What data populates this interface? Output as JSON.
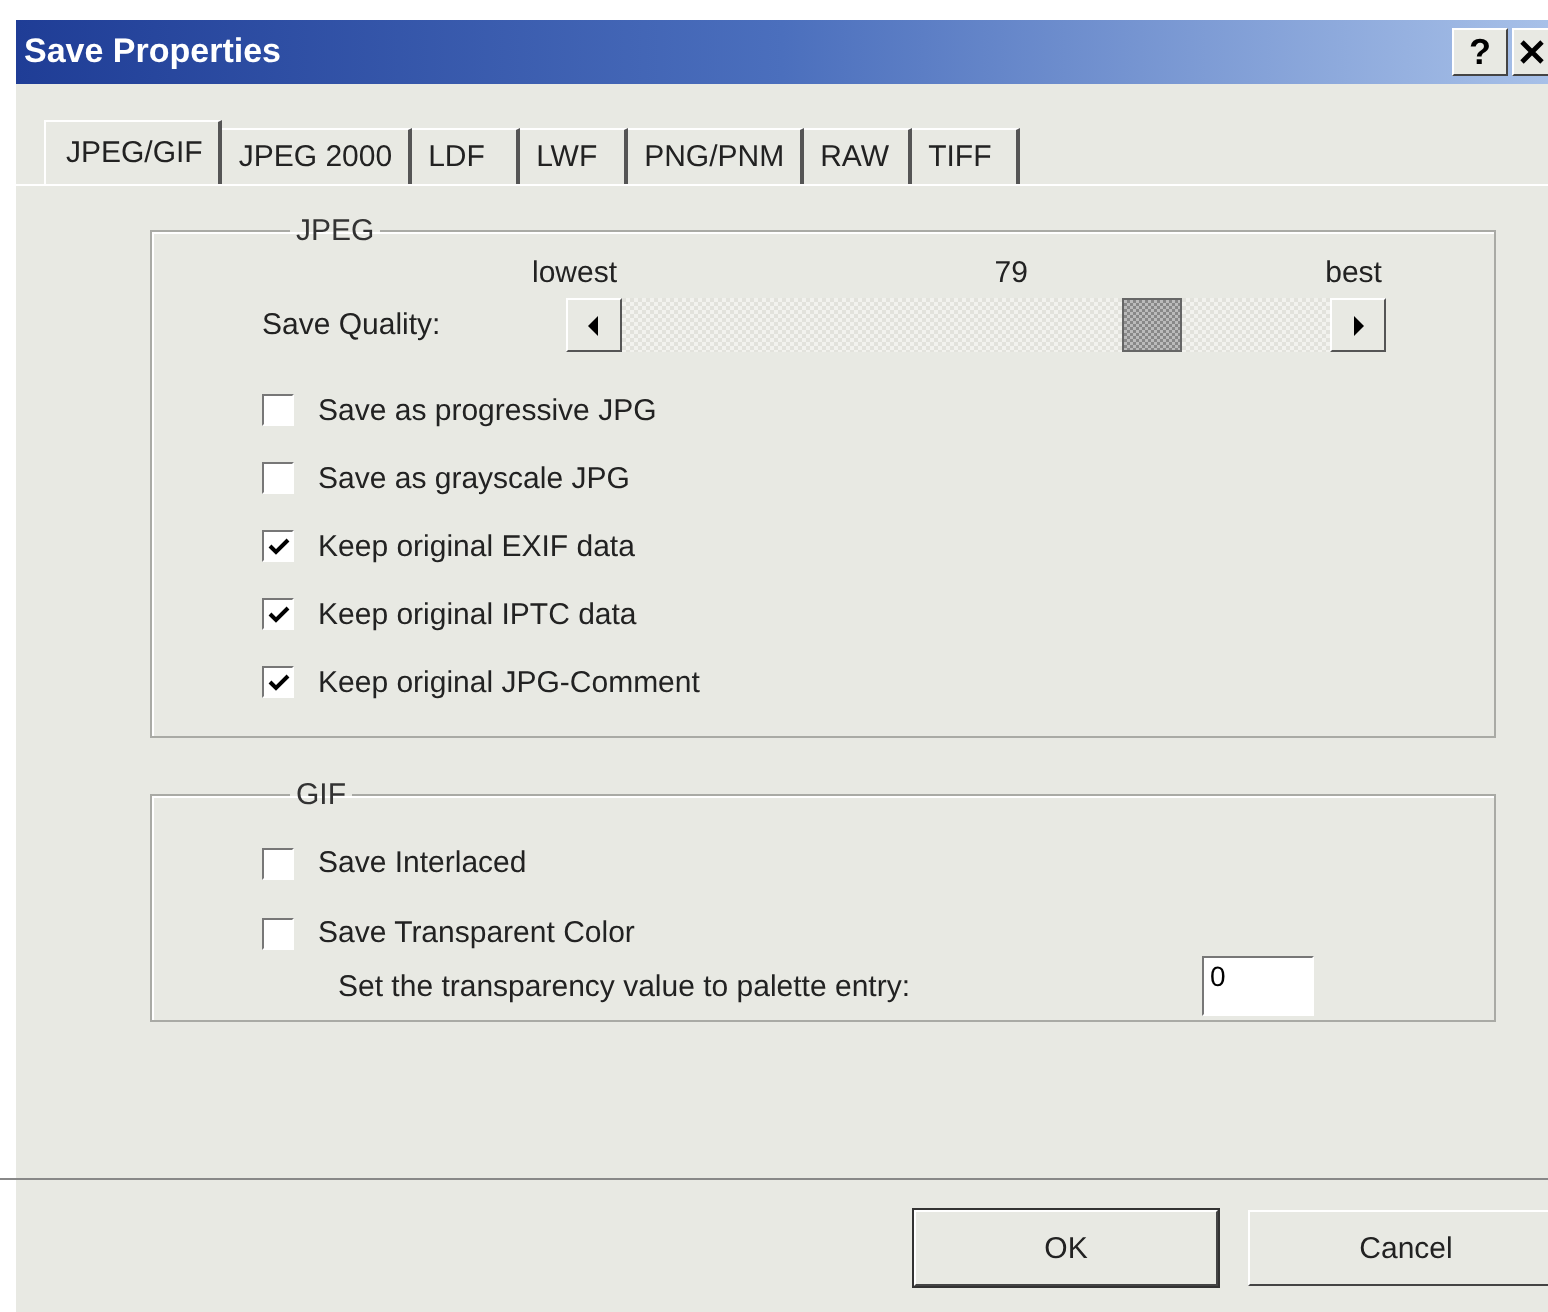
{
  "window": {
    "title": "Save Properties",
    "help": "?"
  },
  "tabs": [
    {
      "label": "JPEG/GIF",
      "selected": true
    },
    {
      "label": "JPEG 2000",
      "selected": false
    },
    {
      "label": "LDF",
      "selected": false
    },
    {
      "label": "LWF",
      "selected": false
    },
    {
      "label": "PNG/PNM",
      "selected": false
    },
    {
      "label": "RAW",
      "selected": false
    },
    {
      "label": "TIFF",
      "selected": false
    }
  ],
  "jpeg": {
    "title": "JPEG",
    "quality": {
      "label": "Save Quality:",
      "min_label": "lowest",
      "value": "79",
      "max_label": "best",
      "level": 0.79
    },
    "options": [
      {
        "label": "Save as progressive JPG",
        "checked": false
      },
      {
        "label": "Save as grayscale JPG",
        "checked": false
      },
      {
        "label": "Keep original EXIF data",
        "checked": true
      },
      {
        "label": "Keep original IPTC data",
        "checked": true
      },
      {
        "label": "Keep original JPG-Comment",
        "checked": true
      }
    ]
  },
  "gif": {
    "title": "GIF",
    "options": [
      {
        "label": "Save Interlaced",
        "checked": false
      },
      {
        "label": "Save Transparent Color",
        "checked": false
      }
    ],
    "palette_entry": {
      "label": "Set the transparency value to palette entry:",
      "value": "0"
    }
  },
  "buttons": [
    "OK",
    "Cancel"
  ]
}
